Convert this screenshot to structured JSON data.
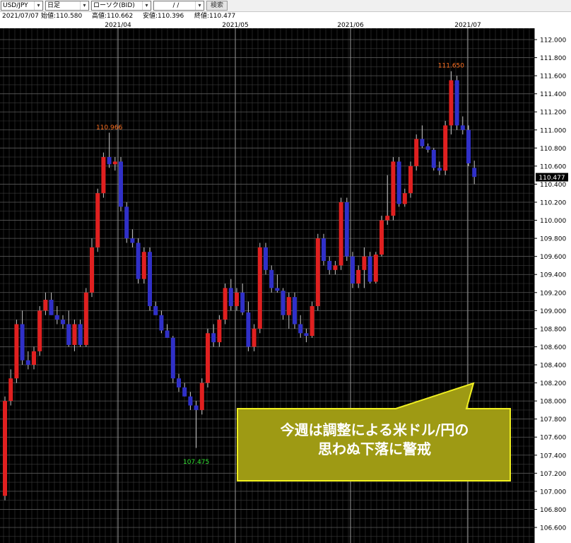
{
  "toolbar": {
    "symbol": "USD/JPY",
    "period": "日足",
    "chart_style": "ローソク(BID)",
    "date": "/ /",
    "search_label": "検索"
  },
  "info": {
    "date": "2021/07/07",
    "open": "始値:110.580",
    "high": "高値:110.662",
    "low": "安値:110.396",
    "close": "終値:110.477"
  },
  "colors": {
    "background": "#000000",
    "grid": "#3a3a3a",
    "up": "#e02020",
    "down": "#3030c8",
    "wick": "#c8c8c8",
    "high_label": "#ff7020",
    "low_label": "#30e030",
    "callout_fill": "#9e9a14",
    "callout_border": "#f0f020",
    "callout_text": "#ffffff"
  },
  "callout": {
    "line1": "今週は調整による米ドル/円の",
    "line2": "思わぬ下落に警戒"
  },
  "chart_data": {
    "type": "candlestick",
    "ylim": [
      106.5,
      112.1
    ],
    "y_ticks": [
      "112.000",
      "111.800",
      "111.600",
      "111.400",
      "111.200",
      "111.000",
      "110.800",
      "110.600",
      "110.400",
      "110.200",
      "110.000",
      "109.800",
      "109.600",
      "109.400",
      "109.200",
      "109.000",
      "108.800",
      "108.600",
      "108.400",
      "108.200",
      "108.000",
      "107.800",
      "107.600",
      "107.400",
      "107.200",
      "107.000",
      "106.800",
      "106.600"
    ],
    "month_labels": [
      "2021/04",
      "2021/05",
      "2021/06",
      "2021/07"
    ],
    "last_price": "110.477",
    "high_annotations": [
      {
        "label": "110.966",
        "value": 110.966
      },
      {
        "label": "111.650",
        "value": 111.65
      }
    ],
    "low_annotations": [
      {
        "label": "107.475",
        "value": 107.475
      }
    ],
    "ohlc": [
      [
        106.95,
        108.05,
        106.9,
        108.0
      ],
      [
        108.0,
        108.35,
        107.95,
        108.25
      ],
      [
        108.25,
        108.9,
        108.2,
        108.85
      ],
      [
        108.85,
        109.0,
        108.4,
        108.45
      ],
      [
        108.45,
        108.55,
        108.35,
        108.4
      ],
      [
        108.4,
        108.6,
        108.35,
        108.55
      ],
      [
        108.55,
        109.05,
        108.5,
        109.0
      ],
      [
        109.0,
        109.2,
        108.95,
        109.12
      ],
      [
        109.12,
        109.2,
        108.95,
        108.95
      ],
      [
        108.95,
        109.05,
        108.85,
        108.9
      ],
      [
        108.9,
        108.95,
        108.8,
        108.85
      ],
      [
        108.85,
        109.0,
        108.6,
        108.62
      ],
      [
        108.62,
        108.9,
        108.55,
        108.85
      ],
      [
        108.85,
        108.9,
        108.6,
        108.62
      ],
      [
        108.62,
        109.25,
        108.6,
        109.2
      ],
      [
        109.2,
        109.8,
        109.15,
        109.7
      ],
      [
        109.7,
        110.35,
        109.65,
        110.3
      ],
      [
        110.3,
        110.75,
        110.25,
        110.7
      ],
      [
        110.7,
        110.97,
        110.58,
        110.62
      ],
      [
        110.62,
        110.7,
        110.55,
        110.65
      ],
      [
        110.65,
        110.7,
        110.1,
        110.15
      ],
      [
        110.15,
        110.2,
        109.75,
        109.8
      ],
      [
        109.8,
        109.9,
        109.7,
        109.75
      ],
      [
        109.75,
        109.8,
        109.3,
        109.35
      ],
      [
        109.35,
        109.7,
        109.3,
        109.65
      ],
      [
        109.65,
        109.7,
        109.0,
        109.05
      ],
      [
        109.05,
        109.1,
        108.95,
        108.95
      ],
      [
        108.95,
        109.0,
        108.75,
        108.78
      ],
      [
        108.78,
        108.85,
        108.7,
        108.7
      ],
      [
        108.7,
        108.72,
        108.2,
        108.25
      ],
      [
        108.25,
        108.3,
        108.1,
        108.15
      ],
      [
        108.15,
        108.2,
        108.05,
        108.05
      ],
      [
        108.05,
        108.1,
        107.9,
        107.95
      ],
      [
        107.95,
        108.0,
        107.48,
        107.9
      ],
      [
        107.9,
        108.25,
        107.85,
        108.2
      ],
      [
        108.2,
        108.8,
        108.15,
        108.75
      ],
      [
        108.75,
        108.85,
        108.6,
        108.65
      ],
      [
        108.65,
        108.95,
        108.6,
        108.9
      ],
      [
        108.9,
        109.3,
        108.85,
        109.25
      ],
      [
        109.25,
        109.35,
        109.0,
        109.05
      ],
      [
        109.05,
        109.25,
        109.0,
        109.2
      ],
      [
        109.2,
        109.3,
        108.95,
        108.98
      ],
      [
        108.98,
        109.1,
        108.55,
        108.6
      ],
      [
        108.6,
        108.85,
        108.55,
        108.8
      ],
      [
        108.8,
        109.75,
        108.75,
        109.7
      ],
      [
        109.7,
        109.75,
        109.4,
        109.45
      ],
      [
        109.45,
        109.5,
        109.2,
        109.25
      ],
      [
        109.25,
        109.4,
        109.2,
        109.22
      ],
      [
        109.22,
        109.25,
        108.9,
        108.95
      ],
      [
        108.95,
        109.2,
        108.8,
        109.15
      ],
      [
        109.15,
        109.2,
        108.8,
        108.85
      ],
      [
        108.85,
        108.95,
        108.7,
        108.75
      ],
      [
        108.75,
        108.8,
        108.65,
        108.72
      ],
      [
        108.72,
        109.1,
        108.7,
        109.05
      ],
      [
        109.05,
        109.85,
        109.0,
        109.8
      ],
      [
        109.8,
        109.85,
        109.5,
        109.55
      ],
      [
        109.55,
        109.6,
        109.4,
        109.45
      ],
      [
        109.45,
        109.55,
        109.4,
        109.5
      ],
      [
        109.5,
        110.25,
        109.45,
        110.2
      ],
      [
        110.2,
        110.25,
        109.55,
        109.6
      ],
      [
        109.6,
        109.65,
        109.25,
        109.3
      ],
      [
        109.3,
        109.5,
        109.25,
        109.45
      ],
      [
        109.45,
        109.7,
        109.25,
        109.6
      ],
      [
        109.6,
        109.65,
        109.3,
        109.32
      ],
      [
        109.32,
        109.65,
        109.3,
        109.62
      ],
      [
        109.62,
        110.05,
        109.6,
        110.0
      ],
      [
        110.0,
        110.5,
        109.95,
        110.05
      ],
      [
        110.05,
        110.7,
        110.0,
        110.65
      ],
      [
        110.65,
        110.7,
        110.15,
        110.18
      ],
      [
        110.18,
        110.35,
        110.15,
        110.3
      ],
      [
        110.3,
        110.65,
        110.25,
        110.6
      ],
      [
        110.6,
        110.95,
        110.55,
        110.9
      ],
      [
        110.9,
        111.05,
        110.8,
        110.82
      ],
      [
        110.82,
        110.85,
        110.75,
        110.78
      ],
      [
        110.78,
        110.8,
        110.55,
        110.58
      ],
      [
        110.58,
        110.65,
        110.5,
        110.55
      ],
      [
        110.55,
        111.1,
        110.5,
        111.05
      ],
      [
        111.05,
        111.65,
        110.95,
        111.55
      ],
      [
        111.55,
        111.6,
        111.0,
        111.05
      ],
      [
        111.05,
        111.15,
        110.95,
        111.0
      ],
      [
        111.0,
        111.05,
        110.6,
        110.63
      ],
      [
        110.58,
        110.66,
        110.4,
        110.48
      ]
    ]
  }
}
